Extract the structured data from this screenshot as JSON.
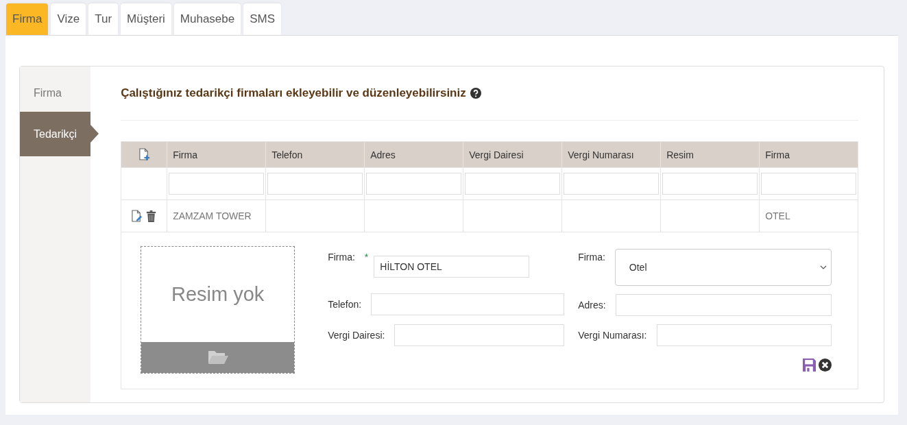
{
  "tabs": [
    {
      "label": "Firma",
      "selected": true
    },
    {
      "label": "Vize",
      "selected": false
    },
    {
      "label": "Tur",
      "selected": false
    },
    {
      "label": "Müşteri",
      "selected": false
    },
    {
      "label": "Muhasebe",
      "selected": false
    },
    {
      "label": "SMS",
      "selected": false
    }
  ],
  "sidebar": {
    "items": [
      {
        "label": "Firma",
        "selected": false
      },
      {
        "label": "Tedarikçi",
        "selected": true
      }
    ]
  },
  "heading": "Çalıştığınız tedarikçi firmaları ekleyebilir ve düzenleyebilirsiniz",
  "table": {
    "columns": [
      "Firma",
      "Telefon",
      "Adres",
      "Vergi Dairesi",
      "Vergi Numarası",
      "Resim",
      "Firma"
    ],
    "rows": [
      {
        "cells": [
          "ZAMZAM TOWER",
          "",
          "",
          "",
          "",
          "",
          "OTEL"
        ]
      }
    ]
  },
  "edit_form": {
    "image_placeholder": "Resim yok",
    "rows": [
      {
        "fields": [
          {
            "kind": "text",
            "label": "Firma:",
            "required": true,
            "value": "HİLTON OTEL"
          },
          {
            "kind": "select",
            "label": "Firma:",
            "required": false,
            "value": "Otel"
          }
        ]
      },
      {
        "fields": [
          {
            "kind": "text",
            "label": "Telefon:",
            "required": false
          },
          {
            "kind": "text",
            "label": "Adres:",
            "required": false
          }
        ]
      },
      {
        "fields": [
          {
            "kind": "text",
            "label": "Vergi Dairesi:",
            "required": false
          },
          {
            "kind": "text",
            "label": "Vergi Numarası:",
            "required": false
          }
        ]
      }
    ],
    "required_mark": "*"
  }
}
